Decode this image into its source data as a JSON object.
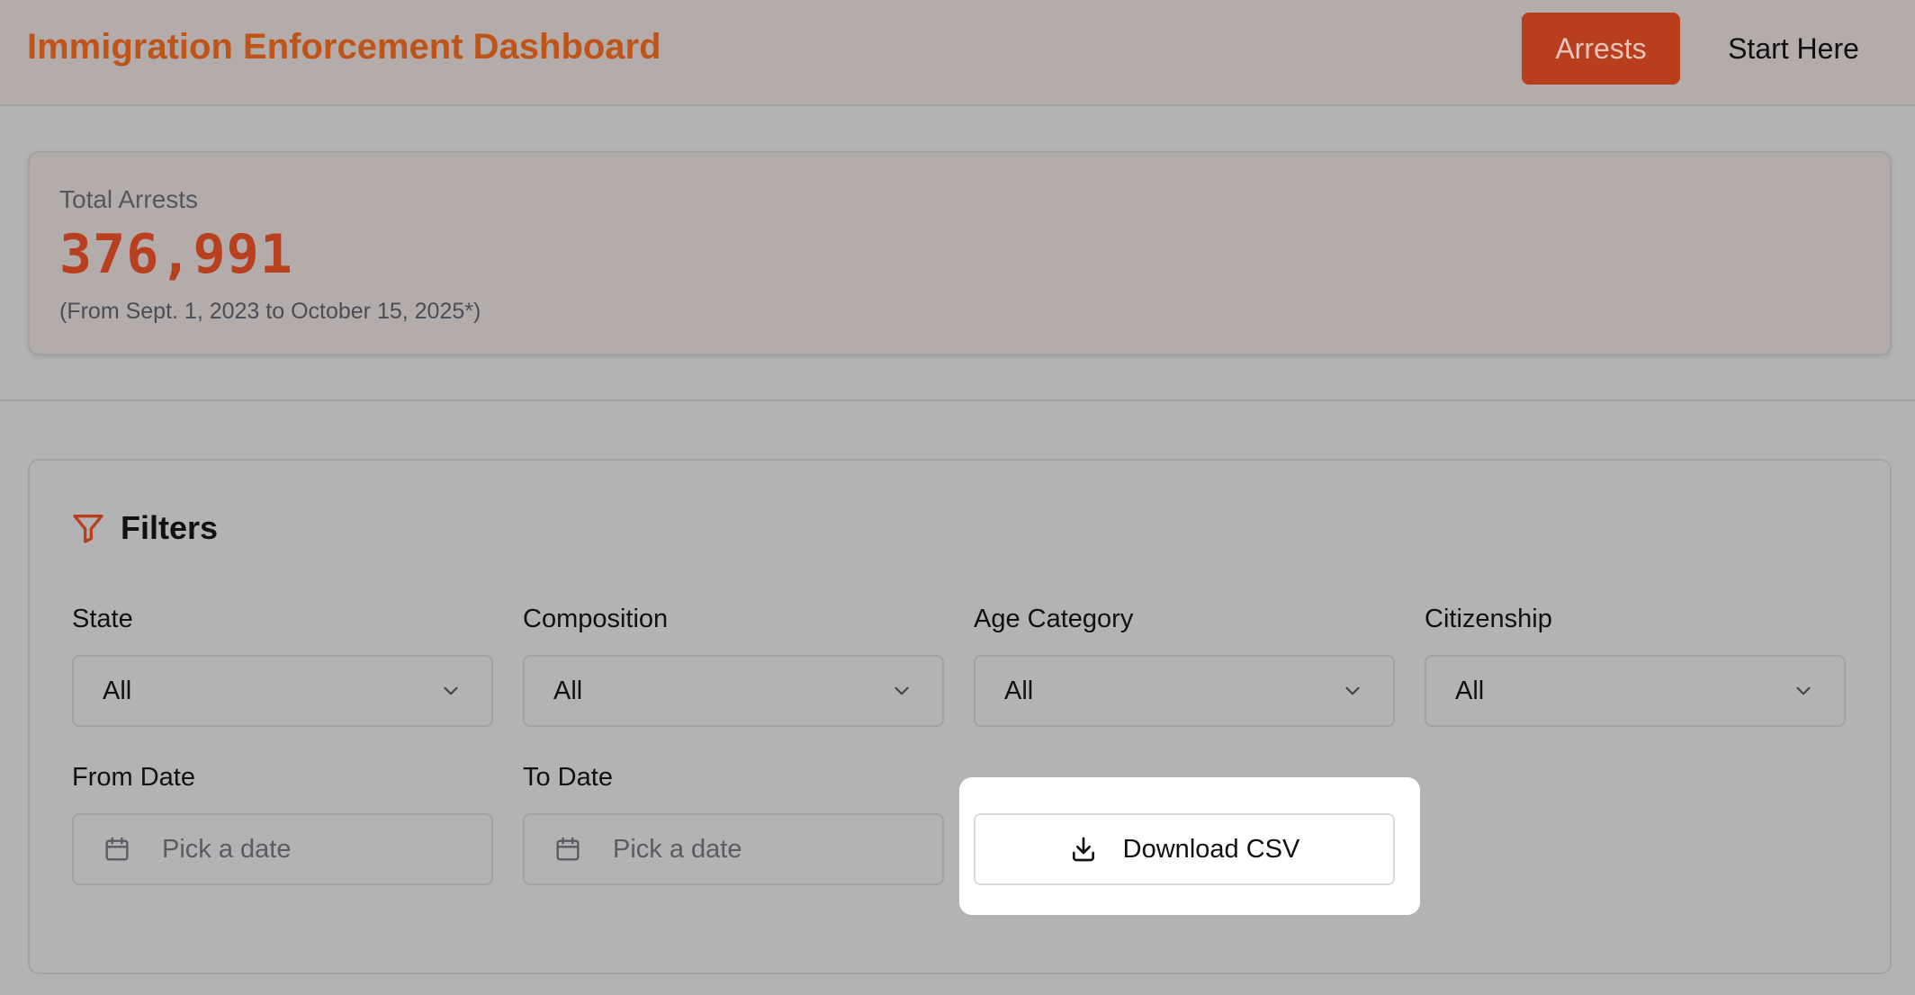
{
  "header": {
    "title": "Immigration Enforcement Dashboard",
    "nav": {
      "arrests_label": "Arrests",
      "start_here_label": "Start Here"
    }
  },
  "stats": {
    "label": "Total Arrests",
    "value": "376,991",
    "note": "(From Sept. 1, 2023 to October 15, 2025*)"
  },
  "filters": {
    "title": "Filters",
    "state": {
      "label": "State",
      "value": "All"
    },
    "composition": {
      "label": "Composition",
      "value": "All"
    },
    "age_category": {
      "label": "Age Category",
      "value": "All"
    },
    "citizenship": {
      "label": "Citizenship",
      "value": "All"
    },
    "from_date": {
      "label": "From Date",
      "placeholder": "Pick a date"
    },
    "to_date": {
      "label": "To Date",
      "placeholder": "Pick a date"
    },
    "download_label": "Download CSV"
  },
  "colors": {
    "accent": "#b8401f",
    "title": "#bf5418",
    "header_bg": "#b4abab",
    "page_bg": "#b3b3b3"
  },
  "icons": {
    "filter": "filter-icon",
    "chevron": "chevron-down-icon",
    "calendar": "calendar-icon",
    "download": "download-icon"
  }
}
